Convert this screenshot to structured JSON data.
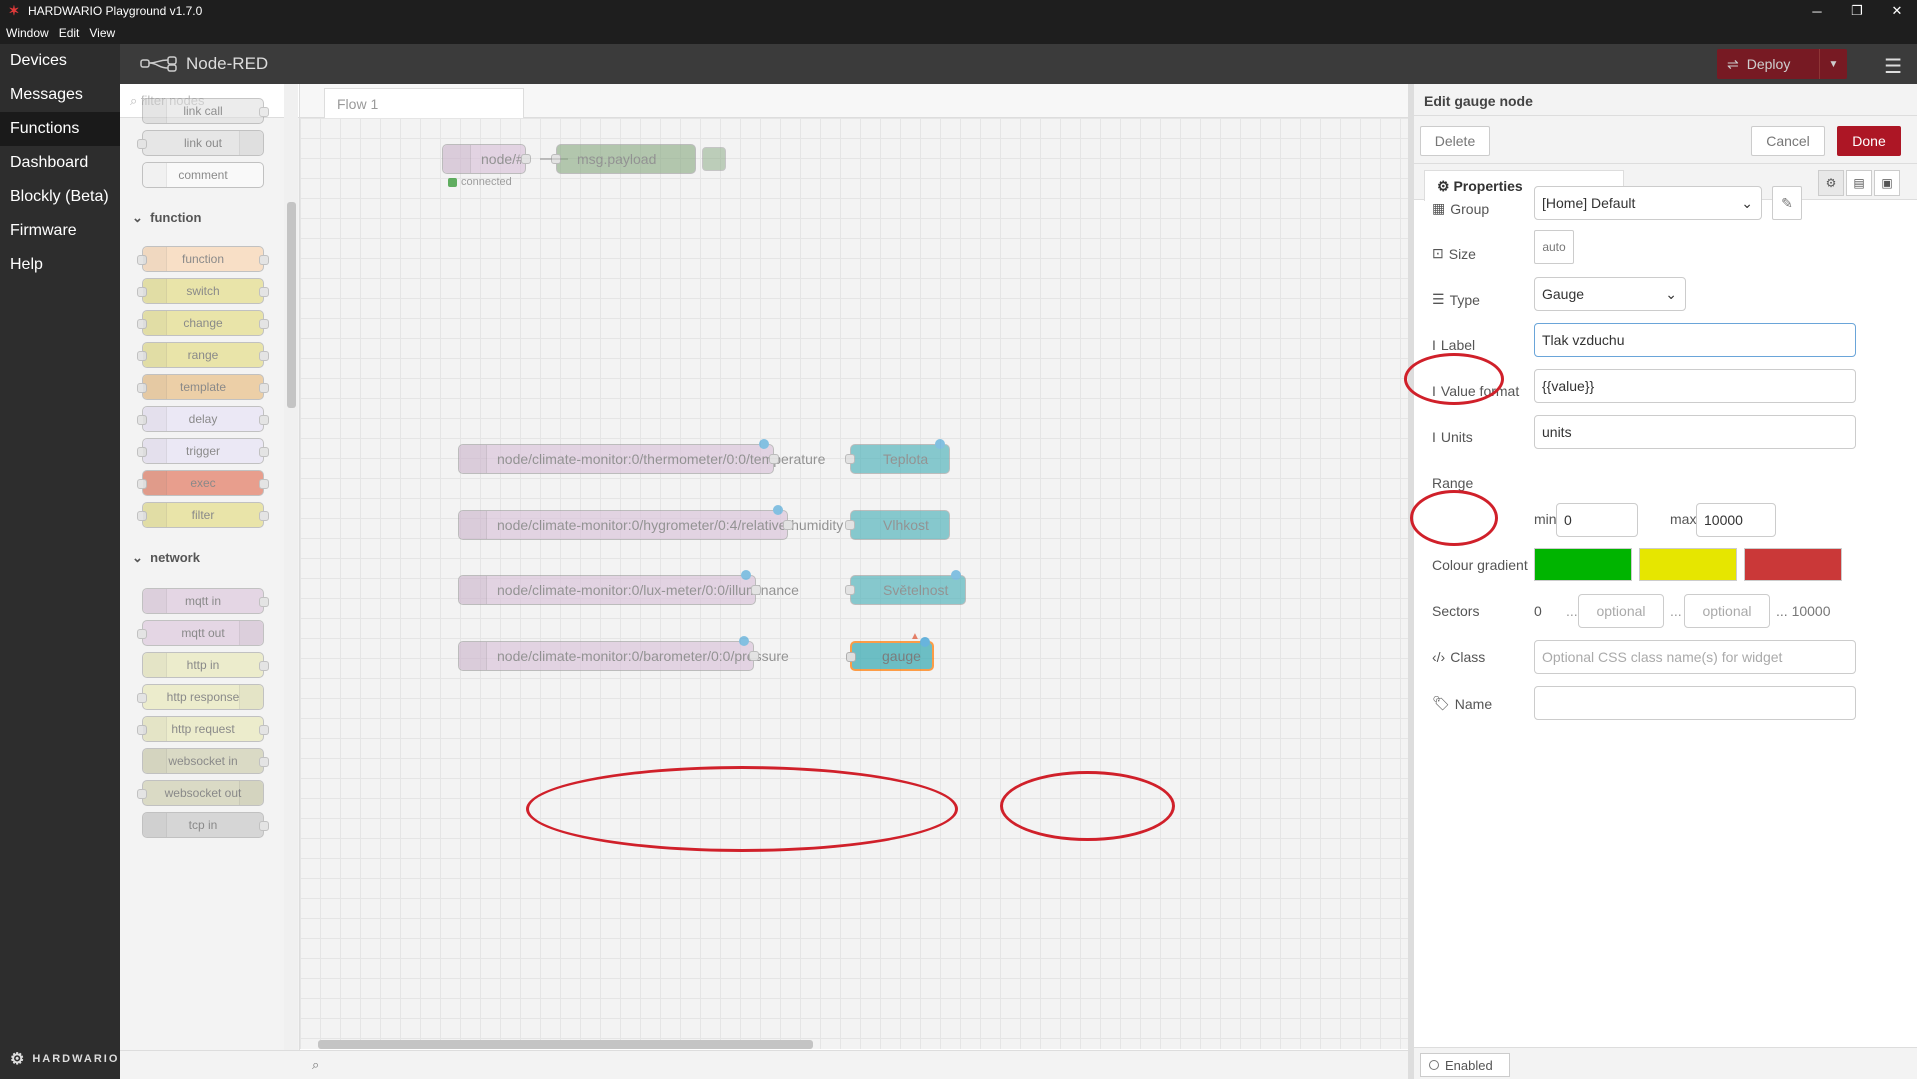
{
  "window": {
    "title": "HARDWARIO Playground v1.7.0",
    "menu": [
      "Window",
      "Edit",
      "View"
    ]
  },
  "app_nav": {
    "items": [
      "Devices",
      "Messages",
      "Functions",
      "Dashboard",
      "Blockly (Beta)",
      "Firmware",
      "Help"
    ],
    "active": "Functions",
    "brand": "HARDWARIO"
  },
  "header": {
    "title": "Node-RED",
    "deploy_label": "Deploy"
  },
  "palette": {
    "filter_placeholder": "filter nodes",
    "top_nodes": [
      "link call",
      "link out",
      "comment"
    ],
    "categories": [
      {
        "name": "function",
        "nodes": [
          "function",
          "switch",
          "change",
          "range",
          "template",
          "delay",
          "trigger",
          "exec",
          "filter"
        ]
      },
      {
        "name": "network",
        "nodes": [
          "mqtt in",
          "mqtt out",
          "http in",
          "http response",
          "http request",
          "websocket in",
          "websocket out",
          "tcp in"
        ]
      }
    ]
  },
  "workspace": {
    "tab": "Flow 1",
    "nodes": {
      "mqtt_all": "node/#",
      "debug": "msg.payload",
      "status_connected": "connected",
      "temperature": "node/climate-monitor:0/thermometer/0:0/temperature",
      "humidity": "node/climate-monitor:0/hygrometer/0:4/relative-humidity",
      "illuminance": "node/climate-monitor:0/lux-meter/0:0/illuminance",
      "pressure": "node/climate-monitor:0/barometer/0:0/pressure",
      "gauge_teplota": "Teplota",
      "gauge_vlhkost": "Vlhkost",
      "gauge_svetelnost": "Světelnost",
      "gauge_new": "gauge"
    }
  },
  "tray": {
    "title": "Edit gauge node",
    "buttons": {
      "delete": "Delete",
      "cancel": "Cancel",
      "done": "Done"
    },
    "tab": "Properties",
    "fields": {
      "group_label": "Group",
      "group_value": "[Home] Default",
      "size_label": "Size",
      "size_value": "auto",
      "type_label": "Type",
      "type_value": "Gauge",
      "label_label": "Label",
      "label_value": "Tlak vzduchu",
      "format_label": "Value format",
      "format_value": "{{value}}",
      "units_label": "Units",
      "units_value": "units",
      "range_label": "Range",
      "min_label": "min",
      "min_value": "0",
      "max_label": "max",
      "max_value": "10000",
      "gradient_label": "Colour gradient",
      "sectors_label": "Sectors",
      "sector_start": "0",
      "sector_ph": "optional",
      "sector_end": "10000",
      "ellipsis": "...",
      "class_label": "Class",
      "class_placeholder": "Optional CSS class name(s) for widget",
      "name_label": "Name",
      "name_value": ""
    },
    "gradient_colors": [
      "#00b400",
      "#e6e600",
      "#ca3838"
    ],
    "enabled_label": "Enabled"
  },
  "colors": {
    "accent": "#ad1625",
    "annotation": "#d0202a",
    "mqtt": "#d8bfd8",
    "gauge": "#3fadb5",
    "debug": "#87a980",
    "function": "#fdd0a2"
  }
}
